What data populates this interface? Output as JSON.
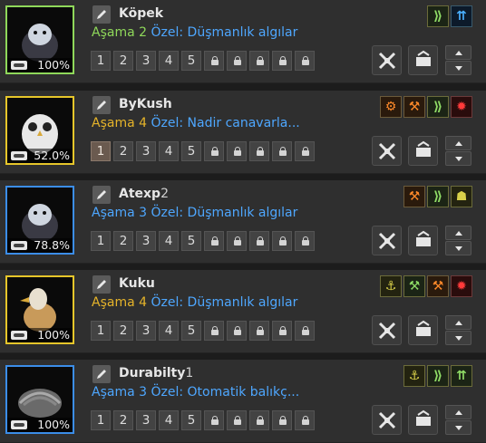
{
  "pets": [
    {
      "id_key": "kopek",
      "name": "Köpek",
      "name_suffix": "",
      "stage_label": "Aşama",
      "stage": "2",
      "special": "Özel: Düşmanlık algılar",
      "food": "100%",
      "frame_color": "#8fd85a",
      "stage_color": "#8fd85a",
      "portrait_animal": "dog",
      "slots": [
        "1",
        "2",
        "3",
        "4",
        "5"
      ],
      "active_slot": -1,
      "locks": 5,
      "skills": [
        {
          "icon": "wings-icon",
          "glyph": "⟫",
          "tone": "green"
        },
        {
          "icon": "double-arrow-icon",
          "glyph": "⇈",
          "tone": "blue"
        }
      ]
    },
    {
      "id_key": "bykush",
      "name": "ByKush",
      "name_suffix": "",
      "stage_label": "Aşama",
      "stage": "4",
      "special": "Özel: Nadir canavarla...",
      "food": "52.0%",
      "frame_color": "#e6c62a",
      "stage_color": "#e6b42a",
      "portrait_animal": "owl",
      "slots": [
        "1",
        "2",
        "3",
        "4",
        "5"
      ],
      "active_slot": 0,
      "locks": 5,
      "skills": [
        {
          "icon": "cart-icon",
          "glyph": "⚙",
          "tone": "orange"
        },
        {
          "icon": "hammer-icon",
          "glyph": "⚒",
          "tone": "orange"
        },
        {
          "icon": "wings-icon",
          "glyph": "⟫",
          "tone": "green"
        },
        {
          "icon": "monster-icon",
          "glyph": "✹",
          "tone": "red"
        }
      ]
    },
    {
      "id_key": "atexp",
      "name": "Atexp",
      "name_suffix": "2",
      "stage_label": "Aşama",
      "stage": "3",
      "special": "Özel: Düşmanlık algılar",
      "food": "78.8%",
      "frame_color": "#3b8de8",
      "stage_color": "#4ea7ff",
      "portrait_animal": "dog",
      "slots": [
        "1",
        "2",
        "3",
        "4",
        "5"
      ],
      "active_slot": -1,
      "locks": 5,
      "skills": [
        {
          "icon": "axe-icon",
          "glyph": "⚒",
          "tone": "orange"
        },
        {
          "icon": "wings-icon",
          "glyph": "⟫",
          "tone": "green"
        },
        {
          "icon": "claw-icon",
          "glyph": "☗",
          "tone": "yellow"
        }
      ]
    },
    {
      "id_key": "kuku",
      "name": "Kuku",
      "name_suffix": "",
      "stage_label": "Aşama",
      "stage": "4",
      "special": "Özel: Düşmanlık algılar",
      "food": "100%",
      "frame_color": "#e6c62a",
      "stage_color": "#e6b42a",
      "portrait_animal": "bird",
      "slots": [
        "1",
        "2",
        "3",
        "4",
        "5"
      ],
      "active_slot": -1,
      "locks": 5,
      "skills": [
        {
          "icon": "hook-icon",
          "glyph": "⚓",
          "tone": "yellow"
        },
        {
          "icon": "pickaxe-icon",
          "glyph": "⚒",
          "tone": "green"
        },
        {
          "icon": "axe-icon",
          "glyph": "⚒",
          "tone": "orange"
        },
        {
          "icon": "monster-icon",
          "glyph": "✹",
          "tone": "red"
        }
      ]
    },
    {
      "id_key": "durabilty",
      "name": "Durabilty",
      "name_suffix": "1",
      "stage_label": "Aşama",
      "stage": "3",
      "special": "Özel: Otomatik balıkç...",
      "food": "100%",
      "frame_color": "#3b8de8",
      "stage_color": "#4ea7ff",
      "portrait_animal": "armadillo",
      "slots": [
        "1",
        "2",
        "3",
        "4",
        "5"
      ],
      "active_slot": -1,
      "locks": 5,
      "skills": [
        {
          "icon": "hook-icon",
          "glyph": "⚓",
          "tone": "yellow"
        },
        {
          "icon": "wings-icon",
          "glyph": "⟫",
          "tone": "green"
        },
        {
          "icon": "double-arrow-icon",
          "glyph": "⇈",
          "tone": "green"
        }
      ]
    }
  ]
}
